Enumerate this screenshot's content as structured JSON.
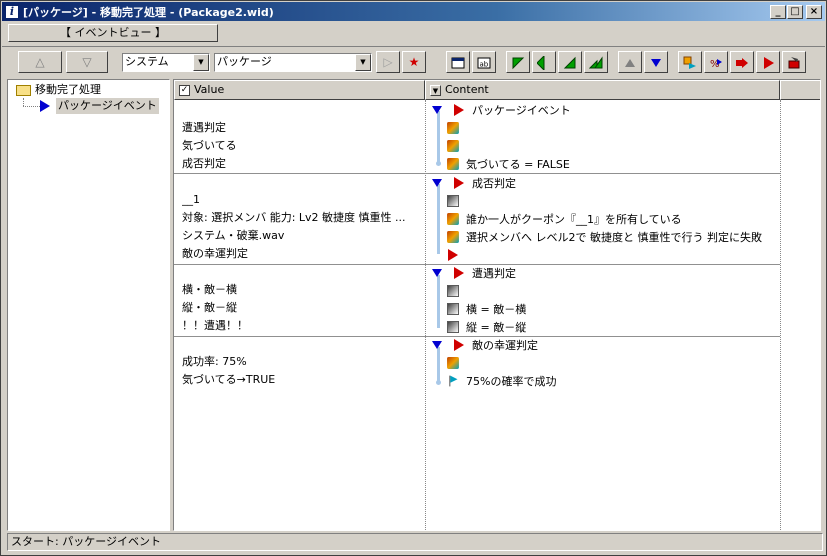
{
  "window": {
    "title": "[パッケージ] - 移動完了処理 - (Package2.wid)",
    "minimize": "_",
    "maximize": "□",
    "close": "×"
  },
  "tab": {
    "label": "【 イベントビュー 】"
  },
  "toolbar": {
    "up_label": "△",
    "down_label": "▽",
    "system_select": "システム",
    "package_select": "パッケージ",
    "play_label": "▷",
    "star_label": "★"
  },
  "tree": {
    "root": "移動完了処理",
    "child": "パッケージイベント"
  },
  "grid": {
    "headers": {
      "value": "Value",
      "content": "Content"
    },
    "blocks": [
      {
        "values": [
          "",
          "遭遇判定",
          "気づいてる",
          "成否判定"
        ],
        "contents": [
          {
            "icon": "event-red-icon",
            "text": "パッケージイベント"
          },
          {
            "icon": "command-icon",
            "text": ""
          },
          {
            "icon": "command-icon",
            "text": ""
          },
          {
            "icon": "command-icon",
            "text": "気づいてる = FALSE"
          }
        ]
      },
      {
        "values": [
          "",
          "__1",
          "対象: 選択メンバ 能力: Lv2 敏捷度 慎重性 ...",
          "システム・破棄.wav",
          "敵の幸運判定"
        ],
        "contents": [
          {
            "icon": "event-red-icon",
            "text": "成否判定"
          },
          {
            "icon": "command-icon",
            "text": ""
          },
          {
            "icon": "command-icon",
            "text": "誰か一人がクーポン『__1』を所有している"
          },
          {
            "icon": "command-icon",
            "text": "選択メンバへ レベル2で 敏捷度と 慎重性で行う 判定に失敗"
          },
          {
            "icon": "command-icon",
            "text": ""
          }
        ]
      },
      {
        "values": [
          "",
          "横・敵－横",
          "縦・敵－縦",
          "！！遭遇！！"
        ],
        "contents": [
          {
            "icon": "event-red-icon",
            "text": "遭遇判定"
          },
          {
            "icon": "command-icon",
            "text": ""
          },
          {
            "icon": "command-icon",
            "text": "横 = 敵－横"
          },
          {
            "icon": "command-icon",
            "text": "縦 = 敵－縦"
          }
        ]
      },
      {
        "values": [
          "",
          "成功率: 75%",
          "気づいてる→TRUE"
        ],
        "contents": [
          {
            "icon": "event-red-icon",
            "text": "敵の幸運判定"
          },
          {
            "icon": "command-icon",
            "text": ""
          },
          {
            "icon": "flag-icon",
            "text": "75%の確率で成功"
          }
        ]
      }
    ]
  },
  "status": {
    "text": "スタート: パッケージイベント"
  }
}
